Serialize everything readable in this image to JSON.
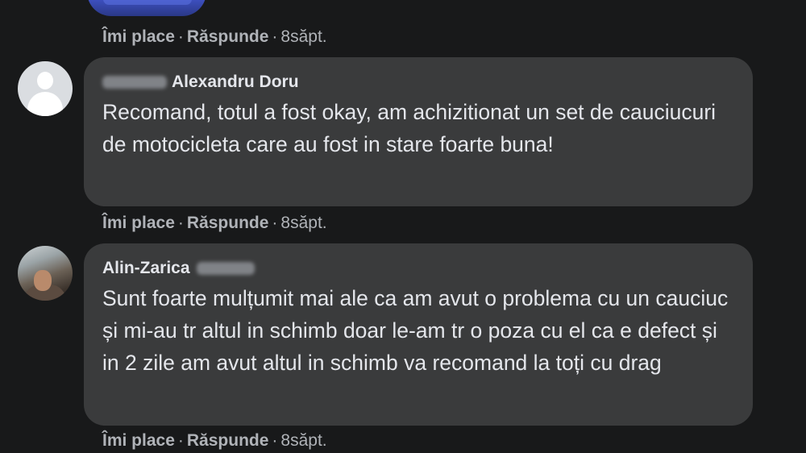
{
  "comments": [
    {
      "author_visible": "Alexandru Doru",
      "text": "Recomand, totul a fost okay, am achizitionat un set de cauciucuri de motocicleta care au fost in stare foarte buna!"
    },
    {
      "author_visible": "Alin-Zarica",
      "text": "Sunt foarte mulțumit mai ale ca am avut o problema cu un cauciuc și mi-au tr altul in schimb doar le-am tr o poza cu el ca e defect și in 2 zile am avut altul in schimb va recomand la toți cu drag"
    }
  ],
  "actions": {
    "like_label": "Îmi place",
    "reply_label": "Răspunde",
    "separator": "·",
    "time_top": "8săpt.",
    "time_1": "8săpt.",
    "time_2": "8săpt."
  },
  "colors": {
    "background": "#18191a",
    "bubble": "#3a3b3c",
    "text": "#e4e6eb",
    "secondary": "#b0b3b8"
  }
}
